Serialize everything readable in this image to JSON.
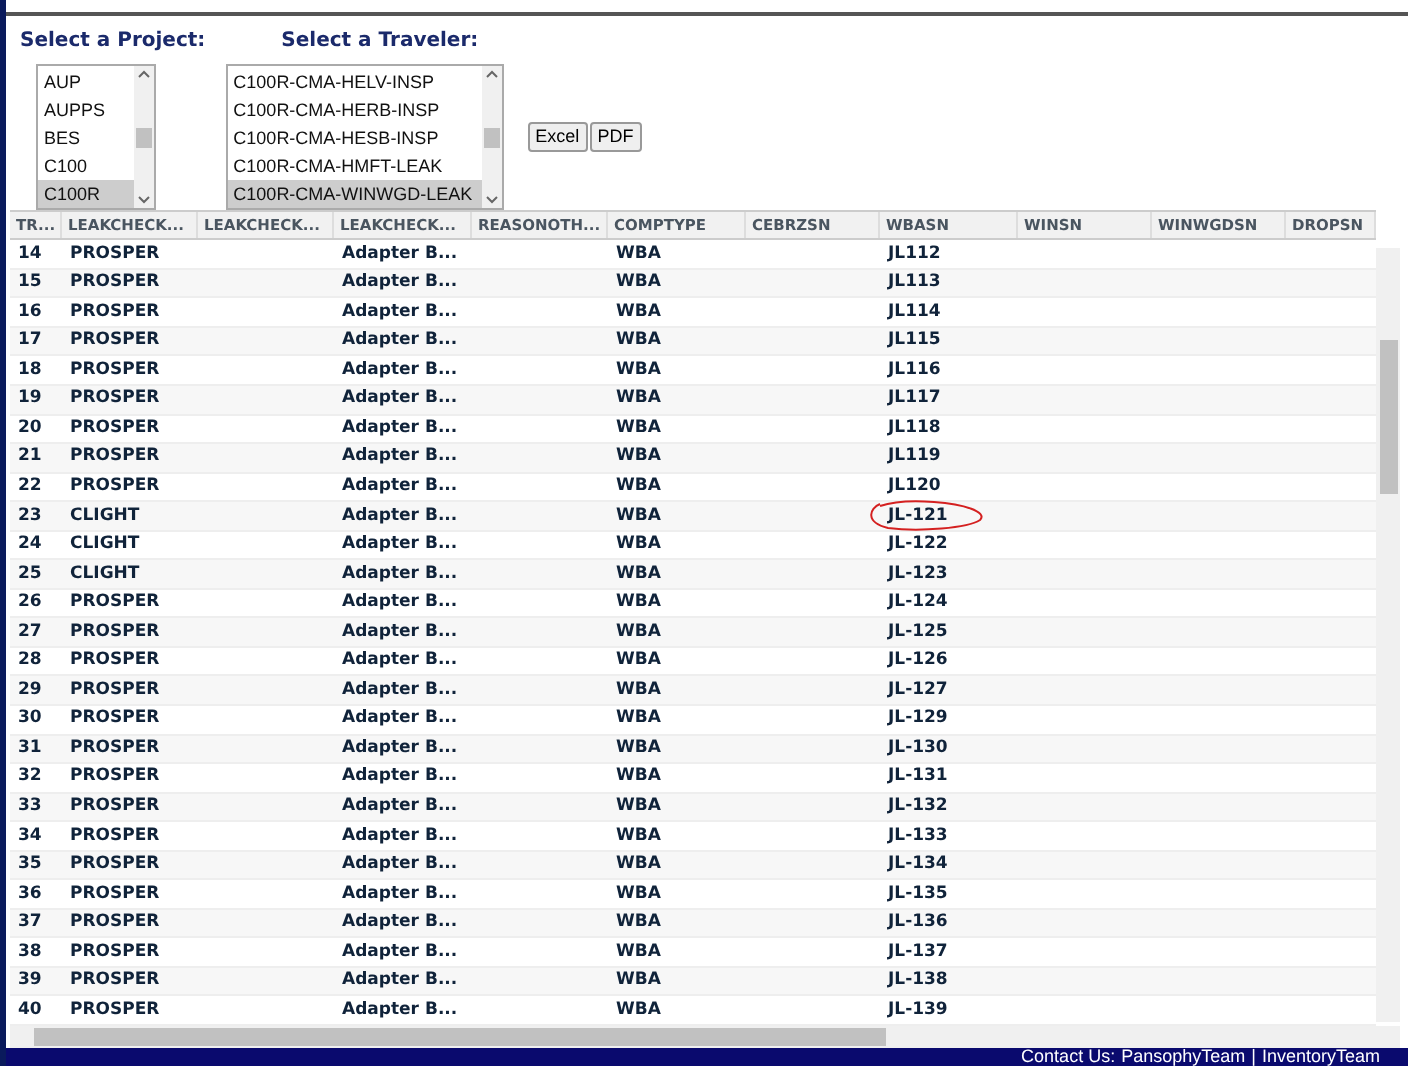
{
  "project_picker": {
    "label": "Select a Project:",
    "options": [
      {
        "label": "AUP",
        "selected": false
      },
      {
        "label": "AUPPS",
        "selected": false
      },
      {
        "label": "BES",
        "selected": false
      },
      {
        "label": "C100",
        "selected": false
      },
      {
        "label": "C100R",
        "selected": true
      }
    ]
  },
  "traveler_picker": {
    "label": "Select a Traveler:",
    "options": [
      {
        "label": "C100R-CMA-HELV-INSP",
        "selected": false
      },
      {
        "label": "C100R-CMA-HERB-INSP",
        "selected": false
      },
      {
        "label": "C100R-CMA-HESB-INSP",
        "selected": false
      },
      {
        "label": "C100R-CMA-HMFT-LEAK",
        "selected": false
      },
      {
        "label": "C100R-CMA-WINWGD-LEAK",
        "selected": true
      }
    ]
  },
  "buttons": [
    "Excel",
    "PDF"
  ],
  "table": {
    "columns": [
      "TR...",
      "LEAKCHECK...",
      "LEAKCHECK...",
      "LEAKCHECK...",
      "REASONOTH...",
      "COMPTYPE",
      "CEBRZSN",
      "WBASN",
      "WINSN",
      "WINWGDSN",
      "DROPSN"
    ],
    "rows": [
      {
        "tr": "14",
        "leakcheck_1": "PROSPER",
        "leakcheck_3": "Adapter B...",
        "comptype": "WBA",
        "wbasn": "JL112",
        "circled": false
      },
      {
        "tr": "15",
        "leakcheck_1": "PROSPER",
        "leakcheck_3": "Adapter B...",
        "comptype": "WBA",
        "wbasn": "JL113",
        "circled": false
      },
      {
        "tr": "16",
        "leakcheck_1": "PROSPER",
        "leakcheck_3": "Adapter B...",
        "comptype": "WBA",
        "wbasn": "JL114",
        "circled": false
      },
      {
        "tr": "17",
        "leakcheck_1": "PROSPER",
        "leakcheck_3": "Adapter B...",
        "comptype": "WBA",
        "wbasn": "JL115",
        "circled": false
      },
      {
        "tr": "18",
        "leakcheck_1": "PROSPER",
        "leakcheck_3": "Adapter B...",
        "comptype": "WBA",
        "wbasn": "JL116",
        "circled": false
      },
      {
        "tr": "19",
        "leakcheck_1": "PROSPER",
        "leakcheck_3": "Adapter B...",
        "comptype": "WBA",
        "wbasn": "JL117",
        "circled": false
      },
      {
        "tr": "20",
        "leakcheck_1": "PROSPER",
        "leakcheck_3": "Adapter B...",
        "comptype": "WBA",
        "wbasn": "JL118",
        "circled": false
      },
      {
        "tr": "21",
        "leakcheck_1": "PROSPER",
        "leakcheck_3": "Adapter B...",
        "comptype": "WBA",
        "wbasn": "JL119",
        "circled": false
      },
      {
        "tr": "22",
        "leakcheck_1": "PROSPER",
        "leakcheck_3": "Adapter B...",
        "comptype": "WBA",
        "wbasn": "JL120",
        "circled": false
      },
      {
        "tr": "23",
        "leakcheck_1": "CLIGHT",
        "leakcheck_3": "Adapter B...",
        "comptype": "WBA",
        "wbasn": "JL-121",
        "circled": true
      },
      {
        "tr": "24",
        "leakcheck_1": "CLIGHT",
        "leakcheck_3": "Adapter B...",
        "comptype": "WBA",
        "wbasn": "JL-122",
        "circled": false
      },
      {
        "tr": "25",
        "leakcheck_1": "CLIGHT",
        "leakcheck_3": "Adapter B...",
        "comptype": "WBA",
        "wbasn": "JL-123",
        "circled": false
      },
      {
        "tr": "26",
        "leakcheck_1": "PROSPER",
        "leakcheck_3": "Adapter B...",
        "comptype": "WBA",
        "wbasn": "JL-124",
        "circled": false
      },
      {
        "tr": "27",
        "leakcheck_1": "PROSPER",
        "leakcheck_3": "Adapter B...",
        "comptype": "WBA",
        "wbasn": "JL-125",
        "circled": false
      },
      {
        "tr": "28",
        "leakcheck_1": "PROSPER",
        "leakcheck_3": "Adapter B...",
        "comptype": "WBA",
        "wbasn": "JL-126",
        "circled": false
      },
      {
        "tr": "29",
        "leakcheck_1": "PROSPER",
        "leakcheck_3": "Adapter B...",
        "comptype": "WBA",
        "wbasn": "JL-127",
        "circled": false
      },
      {
        "tr": "30",
        "leakcheck_1": "PROSPER",
        "leakcheck_3": "Adapter B...",
        "comptype": "WBA",
        "wbasn": "JL-129",
        "circled": false
      },
      {
        "tr": "31",
        "leakcheck_1": "PROSPER",
        "leakcheck_3": "Adapter B...",
        "comptype": "WBA",
        "wbasn": "JL-130",
        "circled": false
      },
      {
        "tr": "32",
        "leakcheck_1": "PROSPER",
        "leakcheck_3": "Adapter B...",
        "comptype": "WBA",
        "wbasn": "JL-131",
        "circled": false
      },
      {
        "tr": "33",
        "leakcheck_1": "PROSPER",
        "leakcheck_3": "Adapter B...",
        "comptype": "WBA",
        "wbasn": "JL-132",
        "circled": false
      },
      {
        "tr": "34",
        "leakcheck_1": "PROSPER",
        "leakcheck_3": "Adapter B...",
        "comptype": "WBA",
        "wbasn": "JL-133",
        "circled": false
      },
      {
        "tr": "35",
        "leakcheck_1": "PROSPER",
        "leakcheck_3": "Adapter B...",
        "comptype": "WBA",
        "wbasn": "JL-134",
        "circled": false
      },
      {
        "tr": "36",
        "leakcheck_1": "PROSPER",
        "leakcheck_3": "Adapter B...",
        "comptype": "WBA",
        "wbasn": "JL-135",
        "circled": false
      },
      {
        "tr": "37",
        "leakcheck_1": "PROSPER",
        "leakcheck_3": "Adapter B...",
        "comptype": "WBA",
        "wbasn": "JL-136",
        "circled": false
      },
      {
        "tr": "38",
        "leakcheck_1": "PROSPER",
        "leakcheck_3": "Adapter B...",
        "comptype": "WBA",
        "wbasn": "JL-137",
        "circled": false
      },
      {
        "tr": "39",
        "leakcheck_1": "PROSPER",
        "leakcheck_3": "Adapter B...",
        "comptype": "WBA",
        "wbasn": "JL-138",
        "circled": false
      },
      {
        "tr": "40",
        "leakcheck_1": "PROSPER",
        "leakcheck_3": "Adapter B...",
        "comptype": "WBA",
        "wbasn": "JL-139",
        "circled": false
      }
    ]
  },
  "footer": {
    "label": "Contact Us:",
    "links": [
      "PansophyTeam",
      "InventoryTeam"
    ],
    "separator": "|"
  }
}
